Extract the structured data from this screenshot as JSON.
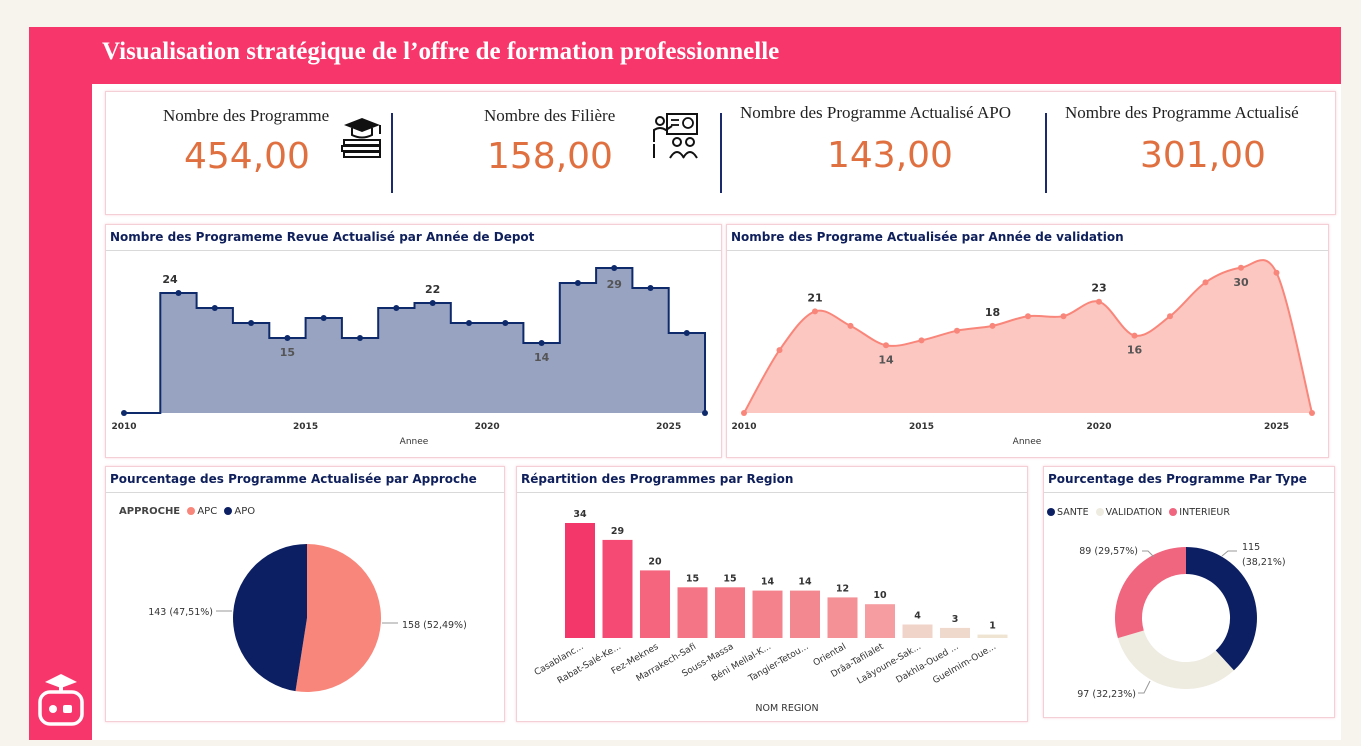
{
  "header": {
    "title": "Visualisation stratégique de l’offre de formation professionnelle"
  },
  "icons": {
    "logo": "robot-graduation-cap-logo",
    "kpi1": "books-graduation-cap-icon",
    "kpi2": "teacher-presentation-icon"
  },
  "kpis": [
    {
      "label": "Nombre des Programme",
      "value": "454,00"
    },
    {
      "label": "Nombre des Filière",
      "value": "158,00"
    },
    {
      "label": "Nombre des Programme Actualisé APO",
      "value": "143,00"
    },
    {
      "label": "Nombre des Programme Actualisé",
      "value": "301,00"
    }
  ],
  "colors": {
    "brand": "#f7376b",
    "kpi_value": "#e0703f",
    "navy": "#0e1f5b",
    "salmon": "#f9867a"
  },
  "chart_data": [
    {
      "id": "depot",
      "type": "area",
      "step": true,
      "title": "Nombre des Programeme Revue Actualisé par Année de Depot",
      "xlabel": "Annee",
      "x": [
        2010,
        2011,
        2012,
        2013,
        2014,
        2015,
        2016,
        2017,
        2018,
        2019,
        2020,
        2021,
        2022,
        2023,
        2024,
        2025,
        2026
      ],
      "values": [
        0,
        24,
        21,
        18,
        15,
        19,
        15,
        21,
        22,
        18,
        18,
        14,
        26,
        29,
        25,
        16,
        0
      ],
      "labels": [
        {
          "x": 2011,
          "text": "24"
        },
        {
          "x": 2014,
          "text": "15"
        },
        {
          "x": 2018,
          "text": "22"
        },
        {
          "x": 2021,
          "text": "14"
        },
        {
          "x": 2023,
          "text": "29"
        }
      ],
      "xticks": [
        "2010",
        "2015",
        "2020",
        "2025"
      ],
      "ylim": [
        0,
        30
      ],
      "color": "#0e2a6b"
    },
    {
      "id": "validation",
      "type": "area",
      "title": "Nombre des Programe Actualisée par Année de validation",
      "xlabel": "Annee",
      "x": [
        2010,
        2011,
        2012,
        2013,
        2014,
        2015,
        2016,
        2017,
        2018,
        2019,
        2020,
        2021,
        2022,
        2023,
        2024,
        2025,
        2026
      ],
      "values": [
        0,
        13,
        21,
        18,
        14,
        15,
        17,
        18,
        20,
        20,
        23,
        16,
        20,
        27,
        30,
        29,
        0
      ],
      "labels": [
        {
          "x": 2012,
          "text": "21"
        },
        {
          "x": 2014,
          "text": "14"
        },
        {
          "x": 2017,
          "text": "18"
        },
        {
          "x": 2020,
          "text": "23"
        },
        {
          "x": 2021,
          "text": "16"
        },
        {
          "x": 2024,
          "text": "30"
        }
      ],
      "xticks": [
        "2010",
        "2015",
        "2020",
        "2025"
      ],
      "ylim": [
        0,
        31
      ],
      "color": "#f9867a"
    },
    {
      "id": "approche",
      "type": "pie",
      "title": "Pourcentage des Programme Actualisée par Approche",
      "legend_title": "APPROCHE",
      "slices": [
        {
          "name": "APC",
          "value": 158,
          "label": "158 (52,49%)",
          "color": "#f9867a"
        },
        {
          "name": "APO",
          "value": 143,
          "label": "143 (47,51%)",
          "color": "#0d1f63"
        }
      ]
    },
    {
      "id": "region",
      "type": "bar",
      "title": "Répartition des Programmes par Region",
      "xlabel": "NOM REGION",
      "categories": [
        "Casablanc...",
        "Rabat-Salé-Ke...",
        "Fez-Meknes",
        "Marrakech-Safi",
        "Souss-Massa",
        "Béni Mellal-K...",
        "Tangier-Tetou...",
        "Oriental",
        "Drâa-Tafilalet",
        "Laâyoune-Sak...",
        "Dakhla-Oued ...",
        "Guelmim-Oue..."
      ],
      "values": [
        34,
        29,
        20,
        15,
        15,
        14,
        14,
        12,
        10,
        4,
        3,
        1
      ],
      "colors": [
        "#f3376a",
        "#f54a73",
        "#f5667e",
        "#f47686",
        "#f47a88",
        "#f4828c",
        "#f48890",
        "#f49197",
        "#f59da1",
        "#f0d3c9",
        "#efd8cc",
        "#efe4d2"
      ]
    },
    {
      "id": "type",
      "type": "pie",
      "donut": true,
      "title": "Pourcentage des Programme Par Type",
      "slices": [
        {
          "name": "SANTE",
          "value": 115,
          "label_l1": "115",
          "label_l2": "(38,21%)",
          "color": "#0d1f63"
        },
        {
          "name": "VALIDATION",
          "value": 97,
          "label": "97 (32,23%)",
          "color": "#eeebe1"
        },
        {
          "name": "INTERIEUR",
          "value": 89,
          "label": "89 (29,57%)",
          "color": "#f0667f"
        }
      ]
    }
  ]
}
